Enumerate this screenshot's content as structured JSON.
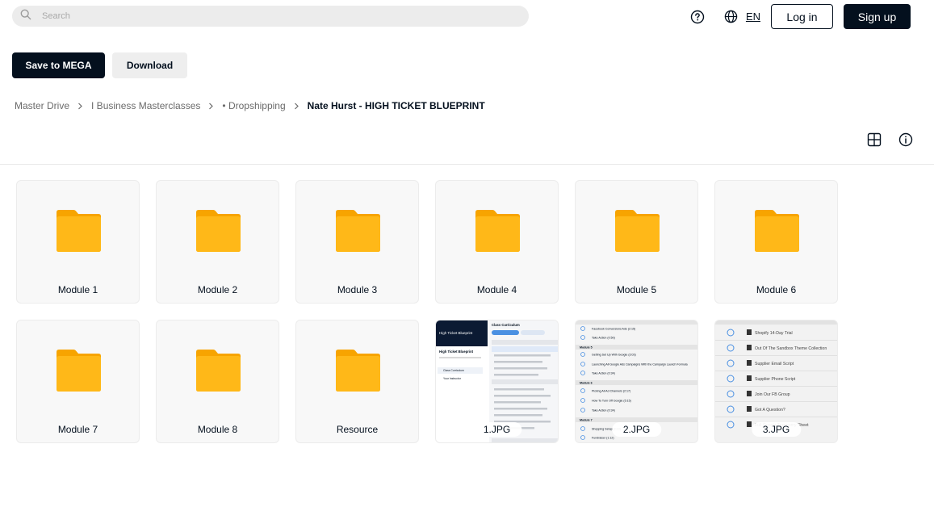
{
  "header": {
    "search_placeholder": "Search",
    "language": "EN",
    "login_label": "Log in",
    "signup_label": "Sign up",
    "help_icon": "help-circle-icon",
    "globe_icon": "globe-icon"
  },
  "actions": {
    "save_label": "Save to MEGA",
    "download_label": "Download"
  },
  "breadcrumb": {
    "items": [
      "Master Drive",
      "I Business Masterclasses",
      "• Dropshipping"
    ],
    "current": "Nate Hurst - HIGH TICKET BLUEPRINT"
  },
  "view_tools": {
    "grid_icon": "grid-view-icon",
    "info_icon": "info-icon"
  },
  "items": [
    {
      "type": "folder",
      "name": "Module 1"
    },
    {
      "type": "folder",
      "name": "Module 2"
    },
    {
      "type": "folder",
      "name": "Module 3"
    },
    {
      "type": "folder",
      "name": "Module 4"
    },
    {
      "type": "folder",
      "name": "Module 5"
    },
    {
      "type": "folder",
      "name": "Module 6"
    },
    {
      "type": "folder",
      "name": "Module 7"
    },
    {
      "type": "folder",
      "name": "Module 8"
    },
    {
      "type": "folder",
      "name": "Resource"
    },
    {
      "type": "image",
      "name": "1.JPG"
    },
    {
      "type": "image",
      "name": "2.JPG"
    },
    {
      "type": "image",
      "name": "3.JPG"
    }
  ],
  "thumbnails": {
    "thumb1": {
      "brand": "High Ticket Blueprint",
      "heading": "Class Curriculum",
      "sidebar_title": "High Ticket Blueprint",
      "sidebar_item_1": "Class Curriculum",
      "sidebar_item_2": "Your Instructor"
    },
    "thumb2": {
      "section_a": "Module 5",
      "section_b": "Module 6",
      "section_c": "Module 7",
      "row_1": "Facebook Conversions Ads (2:15)",
      "row_2": "Take Action (0:50)",
      "row_3": "Getting Set Up With Google (3:03)",
      "row_4": "Launching All Google Ads Campaigns With the Campaign Launch Formula",
      "row_5": "Take Action (0:34)",
      "row_6": "Picking All Ad Channels (2:17)",
      "row_7": "How To Turn Off Google (5:15)",
      "row_8": "Take Action (0:34)",
      "row_9": "Shopping Setup (2:10)",
      "row_10": "Fundraiser (1:12)"
    },
    "thumb3": {
      "row_1": "Shopify 14-Day Trial",
      "row_2": "Out Of The Sandbox Theme Collection",
      "row_3": "Supplier Email Script",
      "row_4": "Supplier Phone Script",
      "row_5": "Join Our FB Group",
      "row_6": "Got A Question?",
      "row_7": "Full Google Taxonomy Sheet"
    }
  },
  "colors": {
    "primary": "#04101e",
    "folder": "#ffb300",
    "folder_tab": "#f7a400",
    "card_bg": "#f8f8f8"
  }
}
